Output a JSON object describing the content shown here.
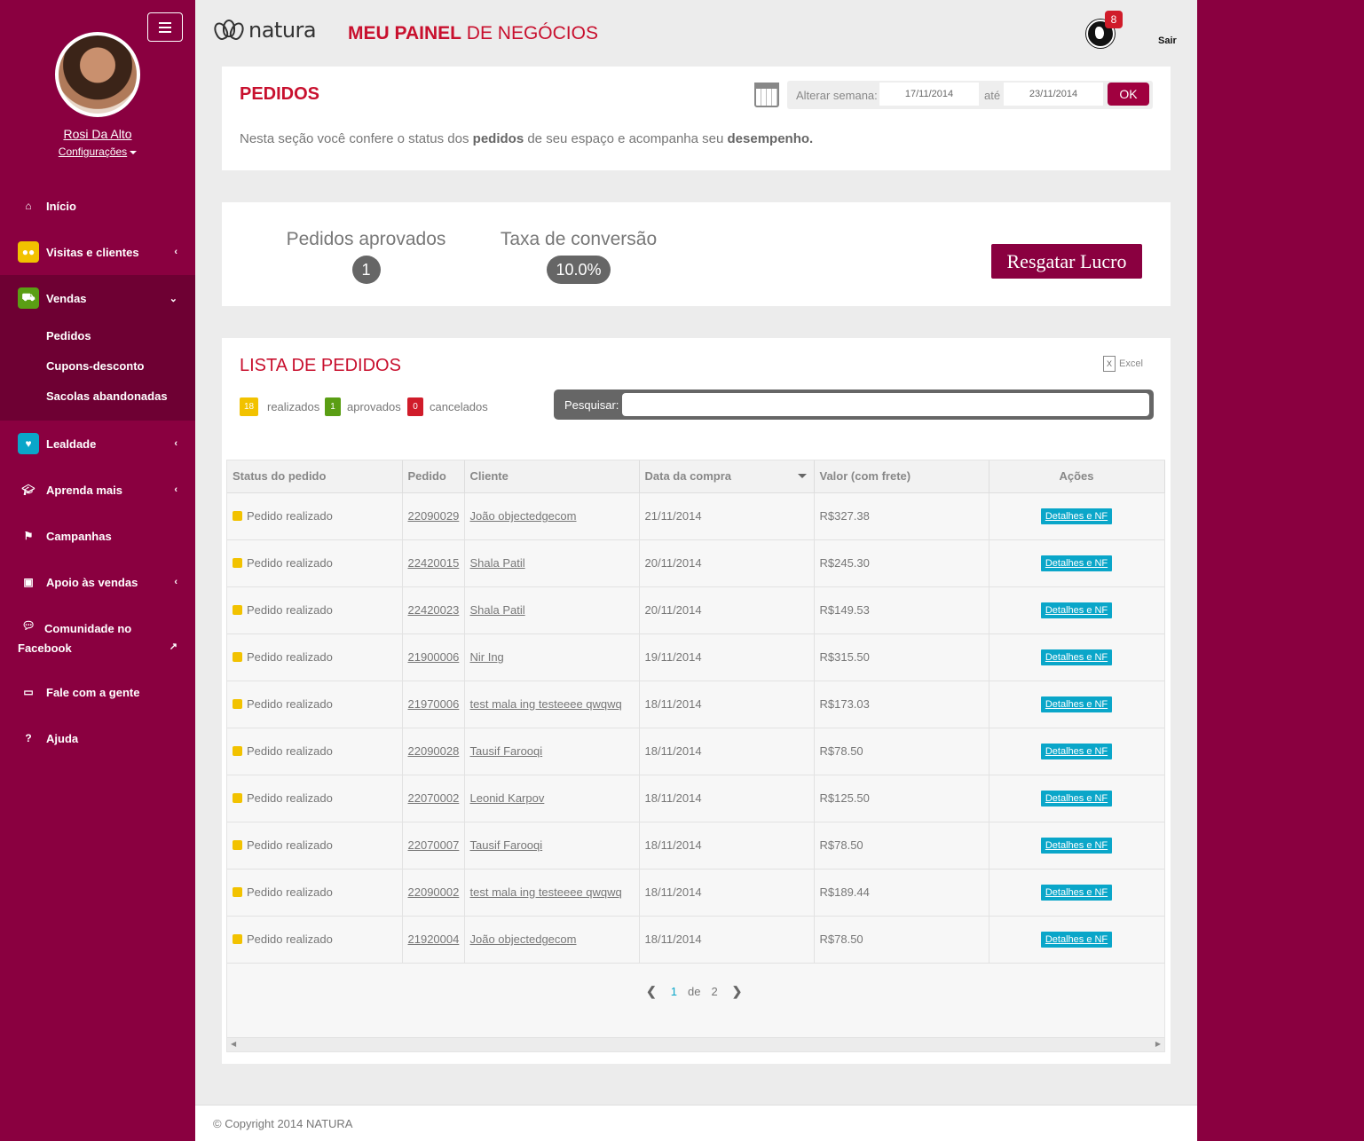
{
  "sidebar": {
    "user_name": "Rosi Da Alto",
    "config_label": "Configurações",
    "items": [
      {
        "label": "Início",
        "icon": "home-icon"
      },
      {
        "label": "Visitas e clientes",
        "icon": "users-icon",
        "icon_color": "#f2c200"
      },
      {
        "label": "Vendas",
        "icon": "cart-icon",
        "icon_color": "#5a9e14"
      },
      {
        "label": "Lealdade",
        "icon": "heart-icon",
        "icon_color": "#0aa6c9"
      },
      {
        "label": "Aprenda mais",
        "icon": "graduation-cap-icon"
      },
      {
        "label": "Campanhas",
        "icon": "flag-icon"
      },
      {
        "label": "Apoio às vendas",
        "icon": "image-icon"
      },
      {
        "label": "Comunidade no Facebook",
        "icon": "comments-icon"
      },
      {
        "label": "Fale com a gente",
        "icon": "chat-icon"
      },
      {
        "label": "Ajuda",
        "icon": "question-icon"
      }
    ],
    "vendas_subitems": [
      "Pedidos",
      "Cupons-desconto",
      "Sacolas abandonadas"
    ]
  },
  "header": {
    "logo_text": "natura",
    "title_bold": "MEU PAINEL",
    "title_rest": " DE NEGÓCIOS",
    "notification_count": "8",
    "logout_label": "Sair"
  },
  "pedidos_panel": {
    "title": "PEDIDOS",
    "week_label": "Alterar semana:",
    "date_start": "17/11/2014",
    "ate_label": "até",
    "date_end": "23/11/2014",
    "ok_label": "OK",
    "intro_part1": "Nesta seção você confere o status dos ",
    "intro_bold1": "pedidos",
    "intro_part2": " de seu espaço e acompanha seu ",
    "intro_bold2": "desempenho."
  },
  "stats": {
    "aprovados_label": "Pedidos aprovados",
    "aprovados_value": "1",
    "conversao_label": "Taxa de conversão",
    "conversao_value": "10.0%",
    "resgatar_label": "Resgatar Lucro"
  },
  "list": {
    "title": "LISTA DE PEDIDOS",
    "excel_label": "Excel",
    "count_realizados": "18",
    "label_realizados": "realizados",
    "count_aprovados": "1",
    "label_aprovados": "aprovados",
    "count_cancelados": "0",
    "label_cancelados": "cancelados",
    "search_label": "Pesquisar:",
    "search_value": "",
    "columns": [
      "Status do pedido",
      "Pedido",
      "Cliente",
      "Data da compra",
      "Valor (com frete)",
      "Ações"
    ],
    "rows": [
      {
        "status": "Pedido realizado",
        "pedido": "22090029",
        "cliente": "João objectedgecom",
        "data": "21/11/2014",
        "valor": "R$327.38",
        "acao": "Detalhes e NF"
      },
      {
        "status": "Pedido realizado",
        "pedido": "22420015",
        "cliente": "Shala Patil",
        "data": "20/11/2014",
        "valor": "R$245.30",
        "acao": "Detalhes e NF"
      },
      {
        "status": "Pedido realizado",
        "pedido": "22420023",
        "cliente": "Shala Patil",
        "data": "20/11/2014",
        "valor": "R$149.53",
        "acao": "Detalhes e NF"
      },
      {
        "status": "Pedido realizado",
        "pedido": "21900006",
        "cliente": "Nir Ing",
        "data": "19/11/2014",
        "valor": "R$315.50",
        "acao": "Detalhes e NF"
      },
      {
        "status": "Pedido realizado",
        "pedido": "21970006",
        "cliente": "test mala ing testeeee qwqwq",
        "data": "18/11/2014",
        "valor": "R$173.03",
        "acao": "Detalhes e NF"
      },
      {
        "status": "Pedido realizado",
        "pedido": "22090028",
        "cliente": "Tausif Farooqi",
        "data": "18/11/2014",
        "valor": "R$78.50",
        "acao": "Detalhes e NF"
      },
      {
        "status": "Pedido realizado",
        "pedido": "22070002",
        "cliente": "Leonid Karpov",
        "data": "18/11/2014",
        "valor": "R$125.50",
        "acao": "Detalhes e NF"
      },
      {
        "status": "Pedido realizado",
        "pedido": "22070007",
        "cliente": "Tausif Farooqi",
        "data": "18/11/2014",
        "valor": "R$78.50",
        "acao": "Detalhes e NF"
      },
      {
        "status": "Pedido realizado",
        "pedido": "22090002",
        "cliente": "test mala ing testeeee qwqwq",
        "data": "18/11/2014",
        "valor": "R$189.44",
        "acao": "Detalhes e NF"
      },
      {
        "status": "Pedido realizado",
        "pedido": "21920004",
        "cliente": "João objectedgecom",
        "data": "18/11/2014",
        "valor": "R$78.50",
        "acao": "Detalhes e NF"
      }
    ],
    "pagination": {
      "current": "1",
      "of_label": "de",
      "total": "2"
    }
  },
  "footer": {
    "copyright": "© Copyright 2014 NATURA"
  },
  "colors": {
    "brand": "#8a0040",
    "accent_red": "#c8102e",
    "action_blue": "#0aa6c9",
    "status_yellow": "#f2c200"
  }
}
